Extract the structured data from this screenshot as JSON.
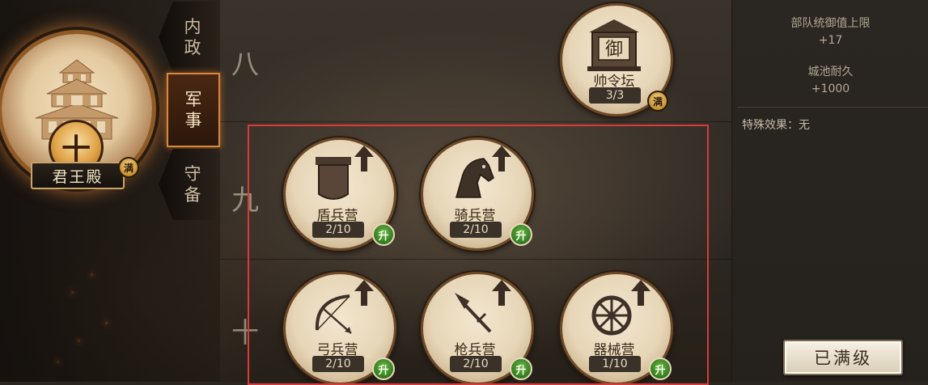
{
  "main_building": {
    "name": "君王殿",
    "rank": "十",
    "badge": "满"
  },
  "side_tabs": [
    {
      "label_top": "内",
      "label_bottom": "政"
    },
    {
      "label_top": "军",
      "label_bottom": "事"
    },
    {
      "label_top": "守",
      "label_bottom": "备"
    }
  ],
  "active_tab": "军事",
  "row_labels": [
    "八",
    "九",
    "十"
  ],
  "buildings": {
    "commander": {
      "name": "帅令坛",
      "level": "3/3",
      "badge": "满",
      "emblem": "御"
    },
    "shield": {
      "name": "盾兵营",
      "level": "2/10",
      "badge": "升"
    },
    "cavalry": {
      "name": "骑兵营",
      "level": "2/10",
      "badge": "升"
    },
    "archer": {
      "name": "弓兵营",
      "level": "2/10",
      "badge": "升"
    },
    "spear": {
      "name": "枪兵营",
      "level": "2/10",
      "badge": "升"
    },
    "siege": {
      "name": "器械营",
      "level": "1/10",
      "badge": "升"
    }
  },
  "info_panel": {
    "stat1_label": "部队统御值上限",
    "stat1_value": "+17",
    "stat2_label": "城池耐久",
    "stat2_value": "+1000",
    "special_effect": "特殊效果：无",
    "max_button": "已满级"
  },
  "icons": {
    "upgrade_arrow": "up-arrow-icon",
    "shield": "shield-icon",
    "horse": "horse-head-icon",
    "bow": "bow-icon",
    "spear": "spear-icon",
    "wheel": "wheel-icon",
    "palace": "palace-icon"
  },
  "colors": {
    "selection_border": "#d93a3a",
    "upgrade_badge": "#2f7a1d",
    "max_badge": "#c7902e"
  }
}
